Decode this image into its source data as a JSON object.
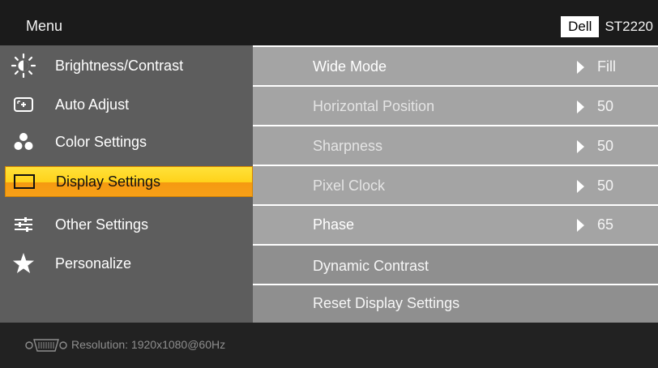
{
  "header": {
    "title": "Menu",
    "brand": "Dell",
    "model": "ST2220"
  },
  "sidebar": {
    "items": [
      {
        "label": "Brightness/Contrast",
        "icon": "brightness-icon"
      },
      {
        "label": "Auto Adjust",
        "icon": "auto-adjust-icon"
      },
      {
        "label": "Color Settings",
        "icon": "color-settings-icon"
      },
      {
        "label": "Display Settings",
        "icon": "display-settings-icon",
        "active": true
      },
      {
        "label": "Other Settings",
        "icon": "other-settings-icon"
      },
      {
        "label": "Personalize",
        "icon": "star-icon"
      }
    ]
  },
  "settings": {
    "rows": [
      {
        "label": "Wide Mode",
        "value": "Fill"
      },
      {
        "label": "Horizontal Position",
        "value": "50"
      },
      {
        "label": "Sharpness",
        "value": "50"
      },
      {
        "label": "Pixel Clock",
        "value": "50"
      },
      {
        "label": "Phase",
        "value": "65"
      },
      {
        "label": "Dynamic Contrast"
      },
      {
        "label": "Reset Display Settings"
      }
    ]
  },
  "footer": {
    "resolution": "Resolution:  1920x1080@60Hz",
    "icon": "vga-connector-icon"
  },
  "colors": {
    "highlight": "#ffd21a",
    "highlight_bottom": "#f59a10",
    "sidebar_bg": "#5d5d5d",
    "row_bg": "#a4a4a4",
    "header_bg": "#1b1b1b"
  }
}
